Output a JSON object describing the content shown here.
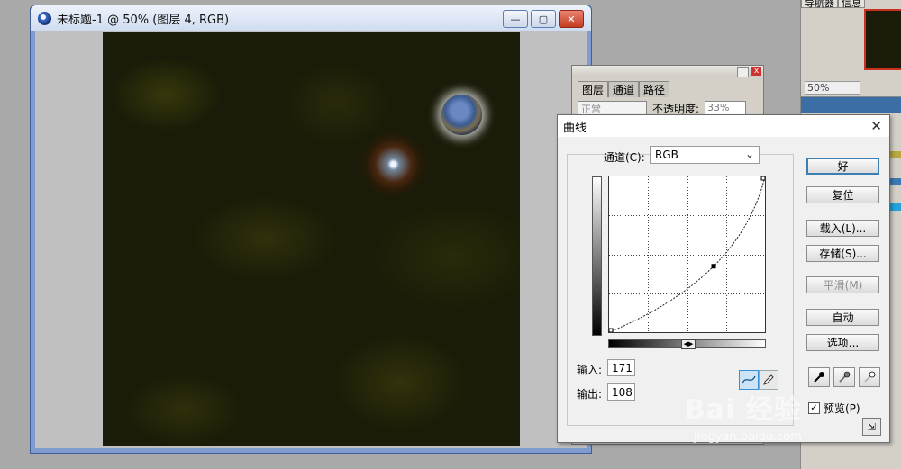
{
  "document": {
    "title": "未标题-1 @ 50% (图层 4, RGB)"
  },
  "navigator": {
    "tabs": [
      "导航器",
      "信息"
    ],
    "zoom": "50%"
  },
  "layers": {
    "tabs": [
      "图层",
      "通道",
      "路径"
    ],
    "blend_mode": "正常",
    "opacity_label": "不透明度:",
    "opacity_value": "33%"
  },
  "curves": {
    "title": "曲线",
    "channel_label": "通道(C):",
    "channel_value": "RGB",
    "input_label": "输入:",
    "input_value": "171",
    "output_label": "输出:",
    "output_value": "108",
    "buttons": {
      "ok": "好",
      "reset": "复位",
      "load": "载入(L)...",
      "save": "存储(S)...",
      "smooth": "平滑(M)",
      "auto": "自动",
      "options": "选项..."
    },
    "preview_label": "预览(P)",
    "preview_checked": true,
    "curve_point": {
      "input": 171,
      "output": 108
    },
    "grid_divisions": 4,
    "value_range": [
      0,
      255
    ]
  },
  "watermark": {
    "brand": "Bai 经验",
    "url": "jingyan.baidu.com"
  }
}
